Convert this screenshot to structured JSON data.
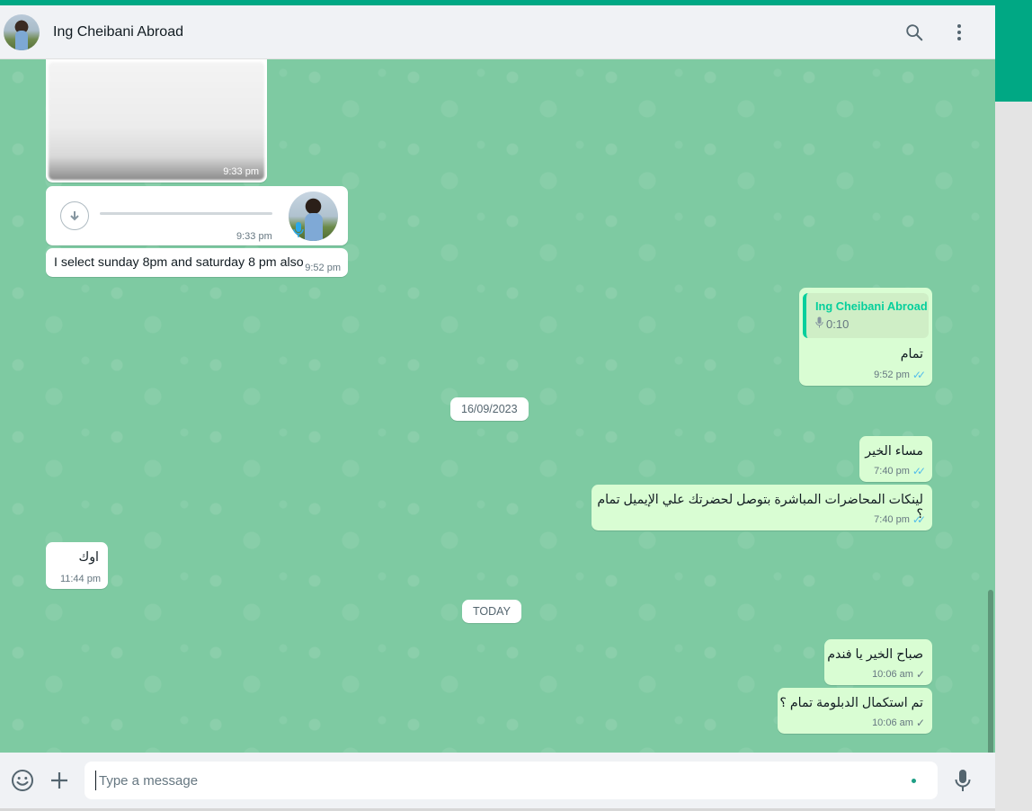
{
  "header": {
    "contact_name": "Ing Cheibani Abroad",
    "icons": [
      "search-icon",
      "menu-icon"
    ]
  },
  "colors": {
    "accent": "#00a884",
    "chat_background": "#7ecaa2",
    "incoming_bubble": "#ffffff",
    "outgoing_bubble": "#d9fdd3",
    "read_tick": "#53bdeb"
  },
  "messages": {
    "image_time": "9:33 pm",
    "voice_time": "9:33 pm",
    "text1": {
      "text": "I select sunday 8pm and saturday 8 pm also",
      "time": "9:52 pm"
    },
    "reply": {
      "quoted_name": "Ing Cheibani Abroad",
      "quoted_duration": "0:10",
      "text": "تمام",
      "time": "9:52 pm"
    },
    "date_sep_1": "16/09/2023",
    "out2": {
      "text": "مساء الخير",
      "time": "7:40 pm"
    },
    "out3": {
      "text": "لينكات المحاضرات المباشرة بتوصل لحضرتك علي الإيميل تمام ؟",
      "time": "7:40 pm"
    },
    "in4": {
      "text": "اوك",
      "time": "11:44 pm"
    },
    "date_sep_2": "TODAY",
    "out5": {
      "text": "صباح الخير يا فندم",
      "time": "10:06 am"
    },
    "out6": {
      "text": "تم استكمال الدبلومة تمام ؟",
      "time": "10:06 am"
    }
  },
  "composer": {
    "placeholder": "Type a message",
    "icons": [
      "emoji-icon",
      "plus-icon",
      "microphone-icon"
    ]
  }
}
